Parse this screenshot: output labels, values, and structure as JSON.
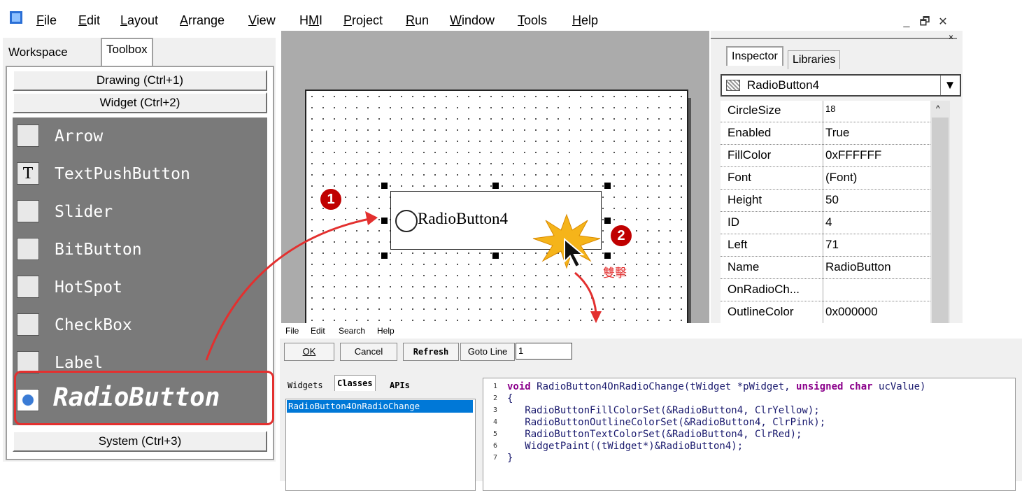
{
  "menubar": {
    "items": [
      {
        "pre": "",
        "u": "F",
        "post": "ile"
      },
      {
        "pre": "",
        "u": "E",
        "post": "dit"
      },
      {
        "pre": "",
        "u": "L",
        "post": "ayout"
      },
      {
        "pre": "",
        "u": "A",
        "post": "rrange"
      },
      {
        "pre": "",
        "u": "V",
        "post": "iew"
      },
      {
        "pre": "H",
        "u": "M",
        "post": "I"
      },
      {
        "pre": "",
        "u": "P",
        "post": "roject"
      },
      {
        "pre": "",
        "u": "R",
        "post": "un"
      },
      {
        "pre": "",
        "u": "W",
        "post": "indow"
      },
      {
        "pre": "",
        "u": "T",
        "post": "ools"
      },
      {
        "pre": "",
        "u": "H",
        "post": "elp"
      }
    ],
    "win_min": "_",
    "win_restore": "🗗",
    "win_close": "✕"
  },
  "left_panel": {
    "tab_workspace": "Workspace",
    "tab_toolbox": "Toolbox",
    "drawing": "Drawing (Ctrl+1)",
    "widget": "Widget (Ctrl+2)",
    "system": "System (Ctrl+3)",
    "widgets": [
      {
        "label": "Arrow",
        "icon": "arrow-icon"
      },
      {
        "label": "TextPushButton",
        "icon": "text-icon"
      },
      {
        "label": "Slider",
        "icon": "slider-icon"
      },
      {
        "label": "BitButton",
        "icon": "bitbutton-icon"
      },
      {
        "label": "HotSpot",
        "icon": "hotspot-icon"
      },
      {
        "label": "CheckBox",
        "icon": "checkbox-icon"
      },
      {
        "label": "Label",
        "icon": "label-icon"
      },
      {
        "label": "RadioButton",
        "icon": "radio-icon"
      }
    ]
  },
  "canvas": {
    "radio_label": "RadioButton4",
    "double_click": "雙擊"
  },
  "annotations": {
    "step1": "1",
    "step2": "2"
  },
  "inspector": {
    "tab_inspector": "Inspector",
    "tab_libraries": "Libraries",
    "object": "RadioButton4",
    "properties": [
      {
        "name": "CircleSize",
        "value": "18"
      },
      {
        "name": "Enabled",
        "value": "True"
      },
      {
        "name": "FillColor",
        "value": "0xFFFFFF"
      },
      {
        "name": "Font",
        "value": "(Font)"
      },
      {
        "name": "Height",
        "value": "50"
      },
      {
        "name": "ID",
        "value": "4"
      },
      {
        "name": "Left",
        "value": "71"
      },
      {
        "name": "Name",
        "value": "RadioButton"
      },
      {
        "name": "OnRadioCh...",
        "value": ""
      },
      {
        "name": "OutlineColor",
        "value": "0x000000"
      }
    ]
  },
  "editor": {
    "menu": [
      "File",
      "Edit",
      "Search",
      "Help"
    ],
    "ok": "OK",
    "cancel": "Cancel",
    "refresh": "Refresh",
    "goto": "Goto Line",
    "goto_value": "1",
    "tabs": [
      "Widgets",
      "Classes",
      "APIs"
    ],
    "selected_class": "RadioButton4OnRadioChange",
    "code": [
      {
        "n": "1",
        "segs": [
          {
            "t": "void",
            "kw": true
          },
          {
            "t": " RadioButton4OnRadioChange(tWidget *pWidget, "
          },
          {
            "t": "unsigned char",
            "kw": true
          },
          {
            "t": " ucValue)"
          }
        ]
      },
      {
        "n": "2",
        "segs": [
          {
            "t": "{"
          }
        ]
      },
      {
        "n": "3",
        "segs": [
          {
            "t": "   RadioButtonFillColorSet(&RadioButton4, ClrYellow);"
          }
        ]
      },
      {
        "n": "4",
        "segs": [
          {
            "t": "   RadioButtonOutlineColorSet(&RadioButton4, ClrPink);"
          }
        ]
      },
      {
        "n": "5",
        "segs": [
          {
            "t": "   RadioButtonTextColorSet(&RadioButton4, ClrRed);"
          }
        ]
      },
      {
        "n": "6",
        "segs": [
          {
            "t": "   WidgetPaint((tWidget*)&RadioButton4);"
          }
        ]
      },
      {
        "n": "7",
        "segs": [
          {
            "t": "}"
          }
        ]
      }
    ]
  },
  "colors": {
    "annotation_red": "#e3302f",
    "badge_red": "#c00000",
    "selection_blue": "#0078d7",
    "keyword": "#8b008b"
  }
}
